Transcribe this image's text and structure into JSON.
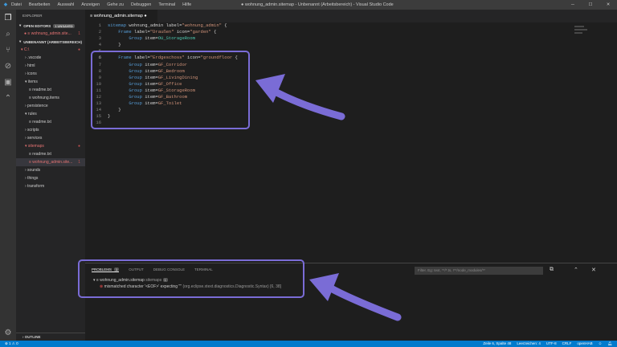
{
  "menu": [
    "Datei",
    "Bearbeiten",
    "Auswahl",
    "Anzeigen",
    "Gehe zu",
    "Debuggen",
    "Terminal",
    "Hilfe"
  ],
  "window_title": "● wohnung_admin.sitemap - Unbenannt (Arbeitsbereich) - Visual Studio Code",
  "sidebar": {
    "header": "EXPLORER",
    "open_editors": "OPEN EDITORS",
    "unsaved": "1 UNSAVED",
    "open_file": "≡ wohnung_admin.site...",
    "open_file_count": "1",
    "workspace": "UNBENANNT (ARBEITSBEREICH)",
    "tree": [
      {
        "label": "▾ C:\\",
        "indent": 0,
        "err": true,
        "dot": true
      },
      {
        "label": "› .vscode",
        "indent": 1
      },
      {
        "label": "› html",
        "indent": 1
      },
      {
        "label": "› icons",
        "indent": 1
      },
      {
        "label": "▾ items",
        "indent": 1
      },
      {
        "label": "≡ readme.txt",
        "indent": 2
      },
      {
        "label": "≡ wohnung.items",
        "indent": 2
      },
      {
        "label": "› persistence",
        "indent": 1
      },
      {
        "label": "▾ rules",
        "indent": 1
      },
      {
        "label": "≡ readme.txt",
        "indent": 2
      },
      {
        "label": "› scripts",
        "indent": 1
      },
      {
        "label": "› services",
        "indent": 1
      },
      {
        "label": "▾ sitemaps",
        "indent": 1,
        "err": true,
        "dot": true
      },
      {
        "label": "≡ readme.txt",
        "indent": 2
      },
      {
        "label": "≡ wohnung_admin.site...",
        "indent": 2,
        "err": true,
        "sel": true,
        "count": "1"
      },
      {
        "label": "› sounds",
        "indent": 1
      },
      {
        "label": "› things",
        "indent": 1
      },
      {
        "label": "› transform",
        "indent": 1
      }
    ],
    "outline": "› OUTLINE"
  },
  "tab": {
    "label": "≡ wohnung_admin.sitemap ●"
  },
  "code": [
    [
      [
        "kw",
        "sitemap"
      ],
      [
        "t",
        " wohnung_admin label="
      ],
      [
        "s",
        "\"wohnung_admin\""
      ],
      [
        "t",
        " {"
      ]
    ],
    [
      [
        "t",
        "    "
      ],
      [
        "kw",
        "Frame"
      ],
      [
        "t",
        " label="
      ],
      [
        "s",
        "\"Draußen\""
      ],
      [
        "t",
        " icon="
      ],
      [
        "s",
        "\"garden\""
      ],
      [
        "t",
        " {"
      ]
    ],
    [
      [
        "t",
        "        "
      ],
      [
        "kw",
        "Group"
      ],
      [
        "t",
        " item="
      ],
      [
        "id",
        "OU_StorageRoom"
      ]
    ],
    [
      [
        "t",
        "    }"
      ]
    ],
    [],
    [
      [
        "t",
        "    "
      ],
      [
        "kw",
        "Frame"
      ],
      [
        "t",
        " label="
      ],
      [
        "s",
        "\"Erdgeschoss\""
      ],
      [
        "t",
        " icon="
      ],
      [
        "s",
        "\"groundfloor"
      ],
      [
        "t",
        " {"
      ]
    ],
    [
      [
        "t",
        "        "
      ],
      [
        "kw",
        "Group"
      ],
      [
        "t",
        " item="
      ],
      [
        "s",
        "GF_Corridor"
      ]
    ],
    [
      [
        "t",
        "        "
      ],
      [
        "kw",
        "Group"
      ],
      [
        "t",
        " item="
      ],
      [
        "s",
        "GF_Bedroom"
      ]
    ],
    [
      [
        "t",
        "        "
      ],
      [
        "kw",
        "Group"
      ],
      [
        "t",
        " item="
      ],
      [
        "s",
        "GF_LivingDining"
      ]
    ],
    [
      [
        "t",
        "        "
      ],
      [
        "kw",
        "Group"
      ],
      [
        "t",
        " item="
      ],
      [
        "s",
        "GF_Office"
      ]
    ],
    [
      [
        "t",
        "        "
      ],
      [
        "kw",
        "Group"
      ],
      [
        "t",
        " item="
      ],
      [
        "s",
        "GF_StorageRoom"
      ]
    ],
    [
      [
        "t",
        "        "
      ],
      [
        "kw",
        "Group"
      ],
      [
        "t",
        " item="
      ],
      [
        "s",
        "GF_Bathroom"
      ]
    ],
    [
      [
        "t",
        "        "
      ],
      [
        "kw",
        "Group"
      ],
      [
        "t",
        " item="
      ],
      [
        "s",
        "GF_Toilet"
      ]
    ],
    [
      [
        "t",
        "    }"
      ]
    ],
    [
      [
        "t",
        "}"
      ]
    ],
    []
  ],
  "panel": {
    "tabs": [
      "PROBLEMS",
      "OUTPUT",
      "DEBUG CONSOLE",
      "TERMINAL"
    ],
    "problems_count": "1",
    "filter_placeholder": "Filter. Eg: text, **/*.ts, !**/node_modules/**",
    "file": "wohnung_admin.sitemap",
    "file_dir": "sitemaps",
    "file_count": "1",
    "error": "mismatched character '<EOF>' expecting '\"'",
    "error_source": "(org.eclipse.xtext.diagnostics.Diagnostic.Syntax)",
    "error_pos": "[6, 38]"
  },
  "status": {
    "errors": "⊗ 1",
    "warnings": "⚠ 0",
    "pos": "Zeile 6, Spalte 48",
    "spaces": "Leerzeichen: 4",
    "enc": "UTF-8",
    "eol": "CRLF",
    "lang": "openHAB"
  },
  "colors": {
    "accent": "#007acc",
    "highlight": "#7a6cd6"
  }
}
